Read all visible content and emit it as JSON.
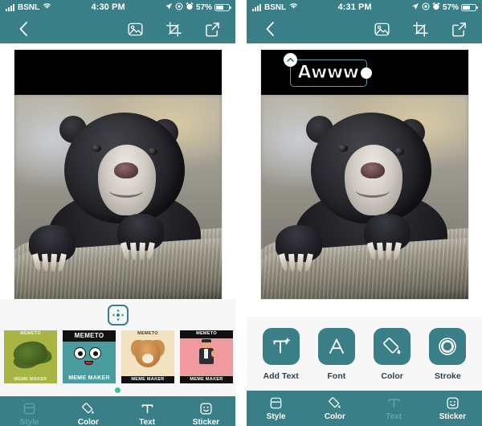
{
  "app": {
    "name": "Memeto Meme Maker"
  },
  "left_phone": {
    "status_bar": {
      "carrier": "BSNL",
      "time": "4:30 PM",
      "battery_percent": "57%",
      "icons": [
        "signal-bars-icon",
        "wifi-icon",
        "location-arrow-icon",
        "screen-record-icon",
        "alarm-clock-icon",
        "battery-icon"
      ]
    },
    "appbar": {
      "back_label": "Back",
      "icons": [
        "back-chevron-icon",
        "photo-icon",
        "crop-icon",
        "share-icon"
      ]
    },
    "canvas": {
      "top_band_text": "",
      "image_alt": "sun bear resting on a log"
    },
    "panel": {
      "move_button_label": "Reposition",
      "templates": [
        {
          "id": "tpl-green-frog",
          "top_caption": "MEMETO",
          "bottom_caption": "MEME MAKER",
          "bg": "#a8b544",
          "selected": false
        },
        {
          "id": "tpl-teal-face",
          "top_caption": "MEMETO",
          "bottom_caption": "MEME MAKER",
          "bg": "#4a9d9c",
          "selected": true
        },
        {
          "id": "tpl-cream-doge",
          "top_caption": "MEMETO",
          "bottom_caption": "MEME MAKER",
          "bg": "#f3e2bf",
          "selected": false
        },
        {
          "id": "tpl-pink-dude",
          "top_caption": "MEMETO",
          "bottom_caption": "MEME MAKER",
          "bg": "#f09a9f",
          "selected": false
        },
        {
          "id": "tpl-tan-frame",
          "top_caption": "",
          "bottom_caption": "",
          "bg": "#e3c18d",
          "selected": false
        }
      ],
      "page_indicator_dots": 1
    },
    "bottom_nav": {
      "items": [
        {
          "label": "Style",
          "icon": "style-icon",
          "active": true
        },
        {
          "label": "Color",
          "icon": "paint-bucket-icon",
          "active": false
        },
        {
          "label": "Text",
          "icon": "text-t-icon",
          "active": false
        },
        {
          "label": "Sticker",
          "icon": "smiley-icon",
          "active": false
        }
      ],
      "active_item": "Style"
    }
  },
  "right_phone": {
    "status_bar": {
      "carrier": "BSNL",
      "time": "4:31 PM",
      "battery_percent": "57%",
      "icons": [
        "signal-bars-icon",
        "wifi-icon",
        "location-arrow-icon",
        "screen-record-icon",
        "alarm-clock-icon",
        "battery-icon"
      ]
    },
    "appbar": {
      "back_label": "Back",
      "icons": [
        "back-chevron-icon",
        "photo-icon",
        "crop-icon",
        "share-icon"
      ]
    },
    "canvas": {
      "overlay_text": "Awww",
      "overlay_text_color": "#ffffff",
      "selection_border_color": "#5d9aa4",
      "handles": [
        "collapse-handle",
        "resize-handle"
      ],
      "image_alt": "sun bear resting on a log"
    },
    "tools": [
      {
        "label": "Add Text",
        "icon": "add-text-icon"
      },
      {
        "label": "Font",
        "icon": "font-a-icon"
      },
      {
        "label": "Color",
        "icon": "paint-bucket-icon"
      },
      {
        "label": "Stroke",
        "icon": "stroke-ring-icon"
      }
    ],
    "bottom_nav": {
      "items": [
        {
          "label": "Style",
          "icon": "style-icon",
          "active": false
        },
        {
          "label": "Color",
          "icon": "paint-bucket-icon",
          "active": false
        },
        {
          "label": "Text",
          "icon": "text-t-icon",
          "active": true
        },
        {
          "label": "Sticker",
          "icon": "smiley-icon",
          "active": false
        }
      ],
      "active_item": "Text"
    }
  },
  "theme": {
    "accent": "#3a7f88",
    "accent_dim": "#5fa5ab",
    "panel_bg": "#f7f7f7",
    "page_bg": "#ffffff",
    "dot_green": "#3fc18f",
    "text_dark": "#33424a"
  }
}
